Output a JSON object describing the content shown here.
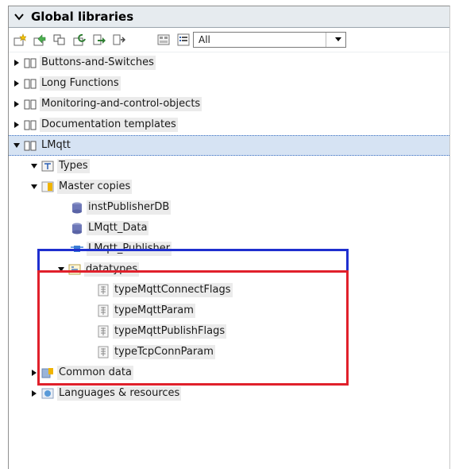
{
  "panel": {
    "title": "Global libraries"
  },
  "toolbar": {
    "icons": [
      "new-library-icon",
      "open-library-icon",
      "save-library-icon",
      "close-library-icon",
      "export-icon",
      "update-icon",
      "library-view-icon",
      "details-view-icon"
    ],
    "filter": {
      "selected": "All"
    }
  },
  "tree": {
    "libs": [
      {
        "label": "Buttons-and-Switches"
      },
      {
        "label": "Long Functions"
      },
      {
        "label": "Monitoring-and-control-objects"
      },
      {
        "label": "Documentation templates"
      },
      {
        "label": "LMqtt"
      }
    ],
    "types": {
      "label": "Types"
    },
    "master_copies": {
      "label": "Master copies"
    },
    "items": [
      {
        "label": "instPublisherDB"
      },
      {
        "label": "LMqtt_Data"
      },
      {
        "label": "LMqtt_Publisher"
      }
    ],
    "datatypes": {
      "label": "datatypes"
    },
    "udts": [
      {
        "label": "typeMqttConnectFlags"
      },
      {
        "label": "typeMqttParam"
      },
      {
        "label": "typeMqttPublishFlags"
      },
      {
        "label": "typeTcpConnParam"
      }
    ],
    "common_data": {
      "label": "Common data"
    },
    "languages": {
      "label": "Languages & resources"
    }
  },
  "colors": {
    "highlight_blue": "#1f2fcf",
    "highlight_red": "#e0202b",
    "selection": "#d6e3f3"
  }
}
